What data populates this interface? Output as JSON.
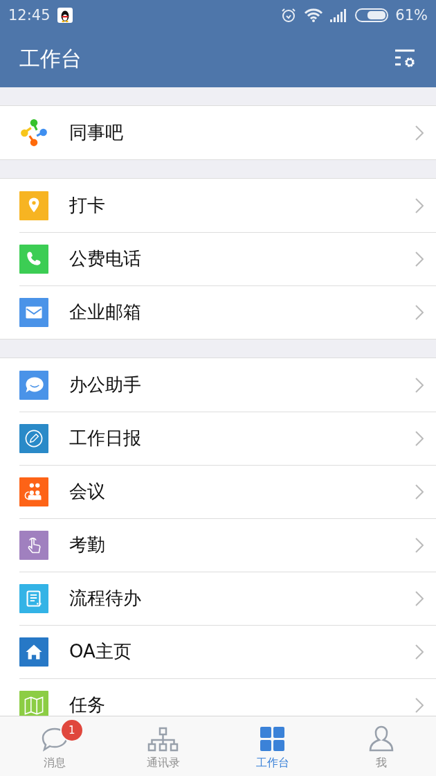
{
  "status_bar": {
    "time": "12:45",
    "battery": "61%"
  },
  "app_bar": {
    "title": "工作台"
  },
  "groups": [
    {
      "items": [
        {
          "label": "同事吧",
          "kind": "pinwheel"
        }
      ]
    },
    {
      "items": [
        {
          "label": "打卡",
          "kind": "pin"
        },
        {
          "label": "公费电话",
          "kind": "phone"
        },
        {
          "label": "企业邮箱",
          "kind": "mail"
        }
      ]
    },
    {
      "items": [
        {
          "label": "办公助手",
          "kind": "chat"
        },
        {
          "label": "工作日报",
          "kind": "pencil"
        },
        {
          "label": "会议",
          "kind": "people"
        },
        {
          "label": "考勤",
          "kind": "hand"
        },
        {
          "label": "流程待办",
          "kind": "form"
        },
        {
          "label": "OA主页",
          "kind": "home"
        },
        {
          "label": "任务",
          "kind": "map"
        }
      ]
    }
  ],
  "bottom_nav": [
    {
      "label": "消息",
      "kind": "chat",
      "selected": false,
      "badge": "1"
    },
    {
      "label": "通讯录",
      "kind": "org",
      "selected": false
    },
    {
      "label": "工作台",
      "kind": "grid",
      "selected": true
    },
    {
      "label": "我",
      "kind": "person",
      "selected": false
    }
  ]
}
